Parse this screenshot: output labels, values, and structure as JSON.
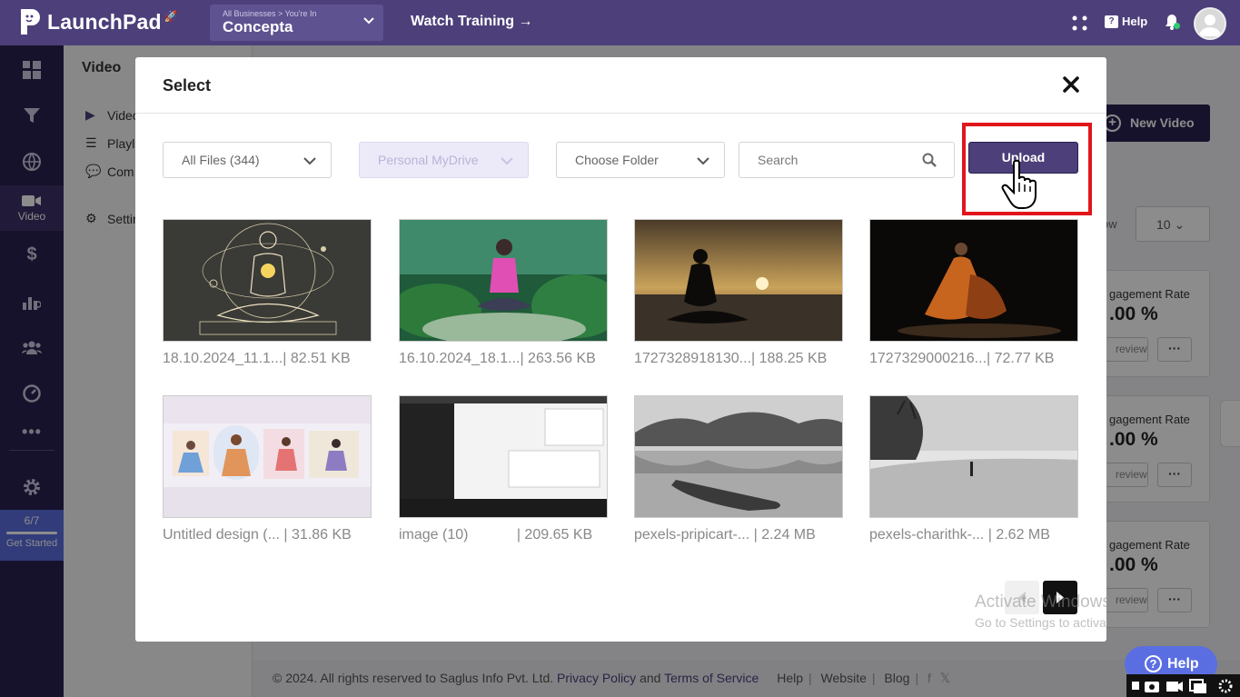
{
  "app": {
    "name": "LaunchPad"
  },
  "business": {
    "crumb": "All Businesses > You're In",
    "name": "Concepta"
  },
  "topbar": {
    "watch_training": "Watch Training →",
    "help": "Help"
  },
  "nav": {
    "items": [
      {
        "icon": "dashboard-icon"
      },
      {
        "icon": "funnel-icon"
      },
      {
        "icon": "globe-icon"
      },
      {
        "icon": "video-camera-icon",
        "label": "Video",
        "active": true
      },
      {
        "icon": "dollar-icon"
      },
      {
        "icon": "analytics-icon"
      },
      {
        "icon": "users-icon"
      },
      {
        "icon": "speedometer-icon"
      },
      {
        "icon": "more-dots-icon"
      },
      {
        "icon": "gear-icon"
      }
    ],
    "get_started": {
      "count": "6/7",
      "label": "Get Started",
      "progress": 0.86
    }
  },
  "subpanel": {
    "title": "Video",
    "items": [
      "Video",
      "Playl",
      "Com",
      "Settin"
    ]
  },
  "background": {
    "new_video": "New Video",
    "show_label": "ow",
    "show_value": "10",
    "cards": [
      {
        "label": "gagement Rate",
        "value": ".00 %",
        "preview": "review",
        "more": "···"
      },
      {
        "label": "gagement Rate",
        "value": ".00 %",
        "preview": "review",
        "more": "···"
      },
      {
        "label": "gagement Rate",
        "value": ".00 %",
        "preview": "review",
        "more": "···"
      }
    ],
    "footer": {
      "copyright": "©  2024. All rights reserved to Saglus Info Pvt. Ltd.",
      "privacy": "Privacy Policy",
      "and": "and",
      "terms": "Terms of Service",
      "links": [
        "Help",
        "Website",
        "Blog"
      ]
    },
    "help_button": "Help"
  },
  "modal": {
    "title": "Select",
    "filters": {
      "files": "All Files (344)",
      "drive": "Personal MyDrive",
      "folder": "Choose Folder",
      "search_placeholder": "Search"
    },
    "upload_label": "Upload",
    "files": [
      {
        "name": "18.10.2024_11.1...",
        "size": "| 82.51 KB"
      },
      {
        "name": "16.10.2024_18.1...",
        "size": "| 263.56 KB"
      },
      {
        "name": "1727328918130...",
        "size": "| 188.25 KB"
      },
      {
        "name": "1727329000216...",
        "size": "| 72.77 KB"
      },
      {
        "name": "Untitled design (...",
        "size": "| 31.86 KB"
      },
      {
        "name": "image (10)",
        "size": "| 209.65 KB"
      },
      {
        "name": "pexels-pripicart-...",
        "size": "| 2.24 MB"
      },
      {
        "name": "pexels-charithk-...",
        "size": "| 2.62 MB"
      }
    ]
  },
  "watermark": {
    "line1": "Activate Windows",
    "line2": "Go to Settings to activate Windows."
  }
}
